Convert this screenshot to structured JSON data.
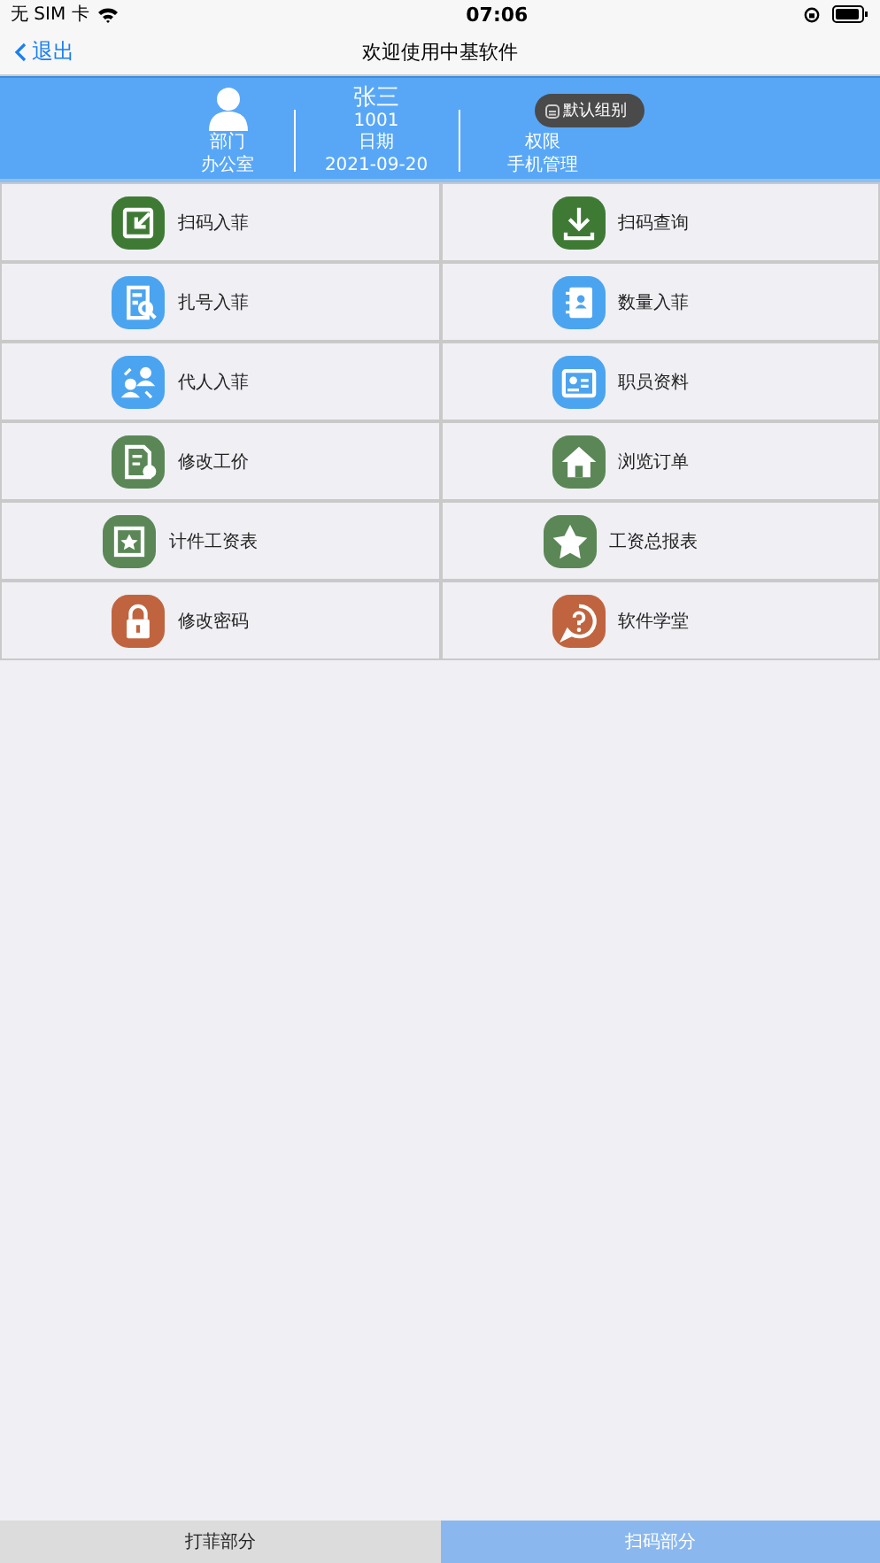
{
  "status_bar": {
    "carrier": "无 SIM 卡",
    "time": "07:06"
  },
  "nav": {
    "back": "退出",
    "title": "欢迎使用中基软件"
  },
  "profile": {
    "department_label": "部门",
    "department": "办公室",
    "name": "张三",
    "id": "1001",
    "date_label": "日期",
    "date": "2021-09-20",
    "role_label": "权限",
    "role": "手机管理"
  },
  "toast": "默认组别",
  "menu": [
    {
      "label": "扫码入菲",
      "color": "#3f7a35"
    },
    {
      "label": "扫码查询",
      "color": "#3f7a35"
    },
    {
      "label": "扎号入菲",
      "color": "#4ba4ef"
    },
    {
      "label": "数量入菲",
      "color": "#4ba4ef"
    },
    {
      "label": "代人入菲",
      "color": "#4ba4ef"
    },
    {
      "label": "职员资料",
      "color": "#4ba4ef"
    },
    {
      "label": "修改工价",
      "color": "#5b8757"
    },
    {
      "label": "浏览订单",
      "color": "#5b8757"
    },
    {
      "label": "计件工资表",
      "color": "#5b8757"
    },
    {
      "label": "工资总报表",
      "color": "#5b8757"
    },
    {
      "label": "修改密码",
      "color": "#c0643f"
    },
    {
      "label": "软件学堂",
      "color": "#c0643f"
    }
  ],
  "tabs": [
    {
      "label": "打菲部分",
      "selected": false
    },
    {
      "label": "扫码部分",
      "selected": true
    }
  ]
}
